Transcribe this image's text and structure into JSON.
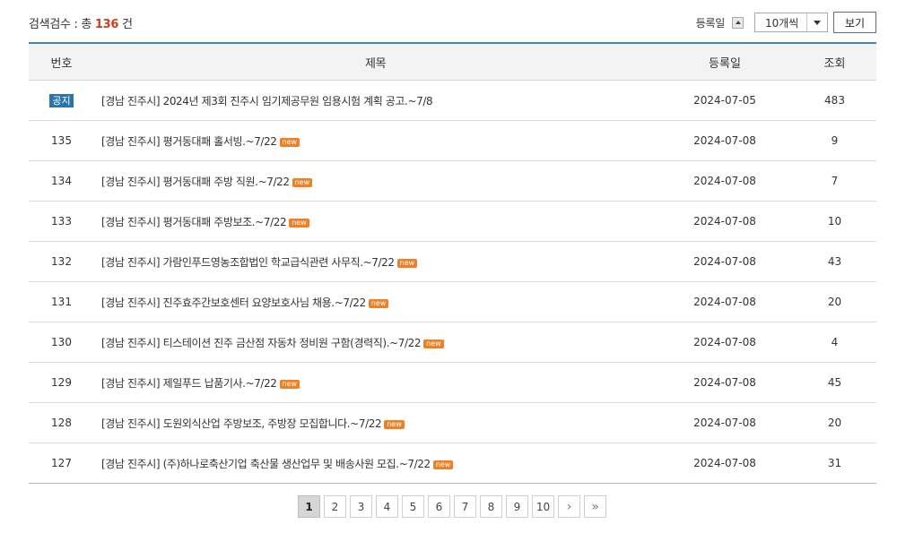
{
  "summary": {
    "prefix": "검색검수 : 총 ",
    "count": "136",
    "suffix": " 건"
  },
  "toolbar": {
    "sort_label": "등록일",
    "per_page": "10개씩",
    "view_label": "보기"
  },
  "columns": {
    "no": "번호",
    "title": "제목",
    "date": "등록일",
    "views": "조회"
  },
  "badges": {
    "notice": "공지",
    "new": "new"
  },
  "rows": [
    {
      "no": "",
      "notice": true,
      "title": "[경남 진주시] 2024년 제3회 진주시 임기제공무원 임용시험 계획 공고.~7/8",
      "is_new": false,
      "date": "2024-07-05",
      "views": "483"
    },
    {
      "no": "135",
      "notice": false,
      "title": "[경남 진주시] 평거동대패 홀서빙.~7/22",
      "is_new": true,
      "date": "2024-07-08",
      "views": "9"
    },
    {
      "no": "134",
      "notice": false,
      "title": "[경남 진주시] 평거동대패 주방 직원.~7/22",
      "is_new": true,
      "date": "2024-07-08",
      "views": "7"
    },
    {
      "no": "133",
      "notice": false,
      "title": "[경남 진주시] 평거동대패 주방보조.~7/22",
      "is_new": true,
      "date": "2024-07-08",
      "views": "10"
    },
    {
      "no": "132",
      "notice": false,
      "title": "[경남 진주시] 가람인푸드영농조합법인 학교급식관련 사무직.~7/22",
      "is_new": true,
      "date": "2024-07-08",
      "views": "43"
    },
    {
      "no": "131",
      "notice": false,
      "title": "[경남 진주시] 진주효주간보호센터 요양보호사님 채용.~7/22",
      "is_new": true,
      "date": "2024-07-08",
      "views": "20"
    },
    {
      "no": "130",
      "notice": false,
      "title": "[경남 진주시] 티스테이션 진주 금산점 자동차 정비원 구함(경력직).~7/22",
      "is_new": true,
      "date": "2024-07-08",
      "views": "4"
    },
    {
      "no": "129",
      "notice": false,
      "title": "[경남 진주시] 제일푸드 납품기사.~7/22",
      "is_new": true,
      "date": "2024-07-08",
      "views": "45"
    },
    {
      "no": "128",
      "notice": false,
      "title": "[경남 진주시] 도원외식산업 주방보조, 주방장 모집합니다.~7/22",
      "is_new": true,
      "date": "2024-07-08",
      "views": "20"
    },
    {
      "no": "127",
      "notice": false,
      "title": "[경남 진주시] (주)하나로축산기업 축산물 생산업무 및 배송사원 모집.~7/22",
      "is_new": true,
      "date": "2024-07-08",
      "views": "31"
    }
  ],
  "pagination": {
    "pages": [
      "1",
      "2",
      "3",
      "4",
      "5",
      "6",
      "7",
      "8",
      "9",
      "10"
    ],
    "current": "1",
    "next": "›",
    "last": "»"
  }
}
